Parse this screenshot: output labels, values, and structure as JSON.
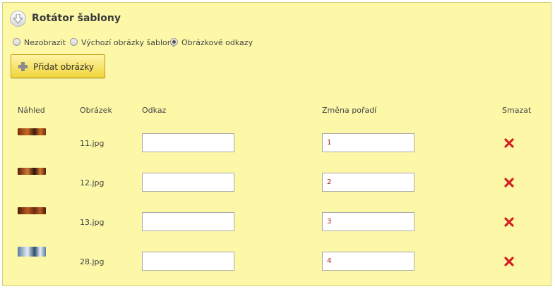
{
  "section": {
    "title": "Rotátor šablony"
  },
  "radios": [
    {
      "label": "Nezobrazit",
      "checked": false
    },
    {
      "label": "Výchozí obrázky šablony",
      "checked": false
    },
    {
      "label": "Obrázkové odkazy",
      "checked": true
    }
  ],
  "add_button": {
    "label": "Přidat obrázky"
  },
  "table": {
    "headers": [
      "Náhled",
      "Obrázek",
      "Odkaz",
      "Změna pořadí",
      "Smazat"
    ],
    "rows": [
      {
        "filename": "11.jpg",
        "link": "",
        "order": "1",
        "thumb_colors": [
          "#7a2a10",
          "#c86a20",
          "#3a1a10"
        ]
      },
      {
        "filename": "12.jpg",
        "link": "",
        "order": "2",
        "thumb_colors": [
          "#5a1a10",
          "#d07a30",
          "#2a0f08"
        ]
      },
      {
        "filename": "13.jpg",
        "link": "",
        "order": "3",
        "thumb_colors": [
          "#4a1a0c",
          "#b85a20",
          "#6a2a10"
        ]
      },
      {
        "filename": "28.jpg",
        "link": "",
        "order": "4",
        "thumb_colors": [
          "#5a7aa0",
          "#e8eef5",
          "#2a4a6a"
        ]
      }
    ]
  },
  "colors": {
    "panel_bg": "#fcf8a8",
    "button_gradient_top": "#fff5a8",
    "button_gradient_bottom": "#f0d43a",
    "order_text": "#9b1a1a",
    "delete_icon": "#d42020"
  },
  "icons": {
    "collapse": "arrow-down-icon",
    "add": "plus-icon",
    "delete": "red-x-icon"
  }
}
